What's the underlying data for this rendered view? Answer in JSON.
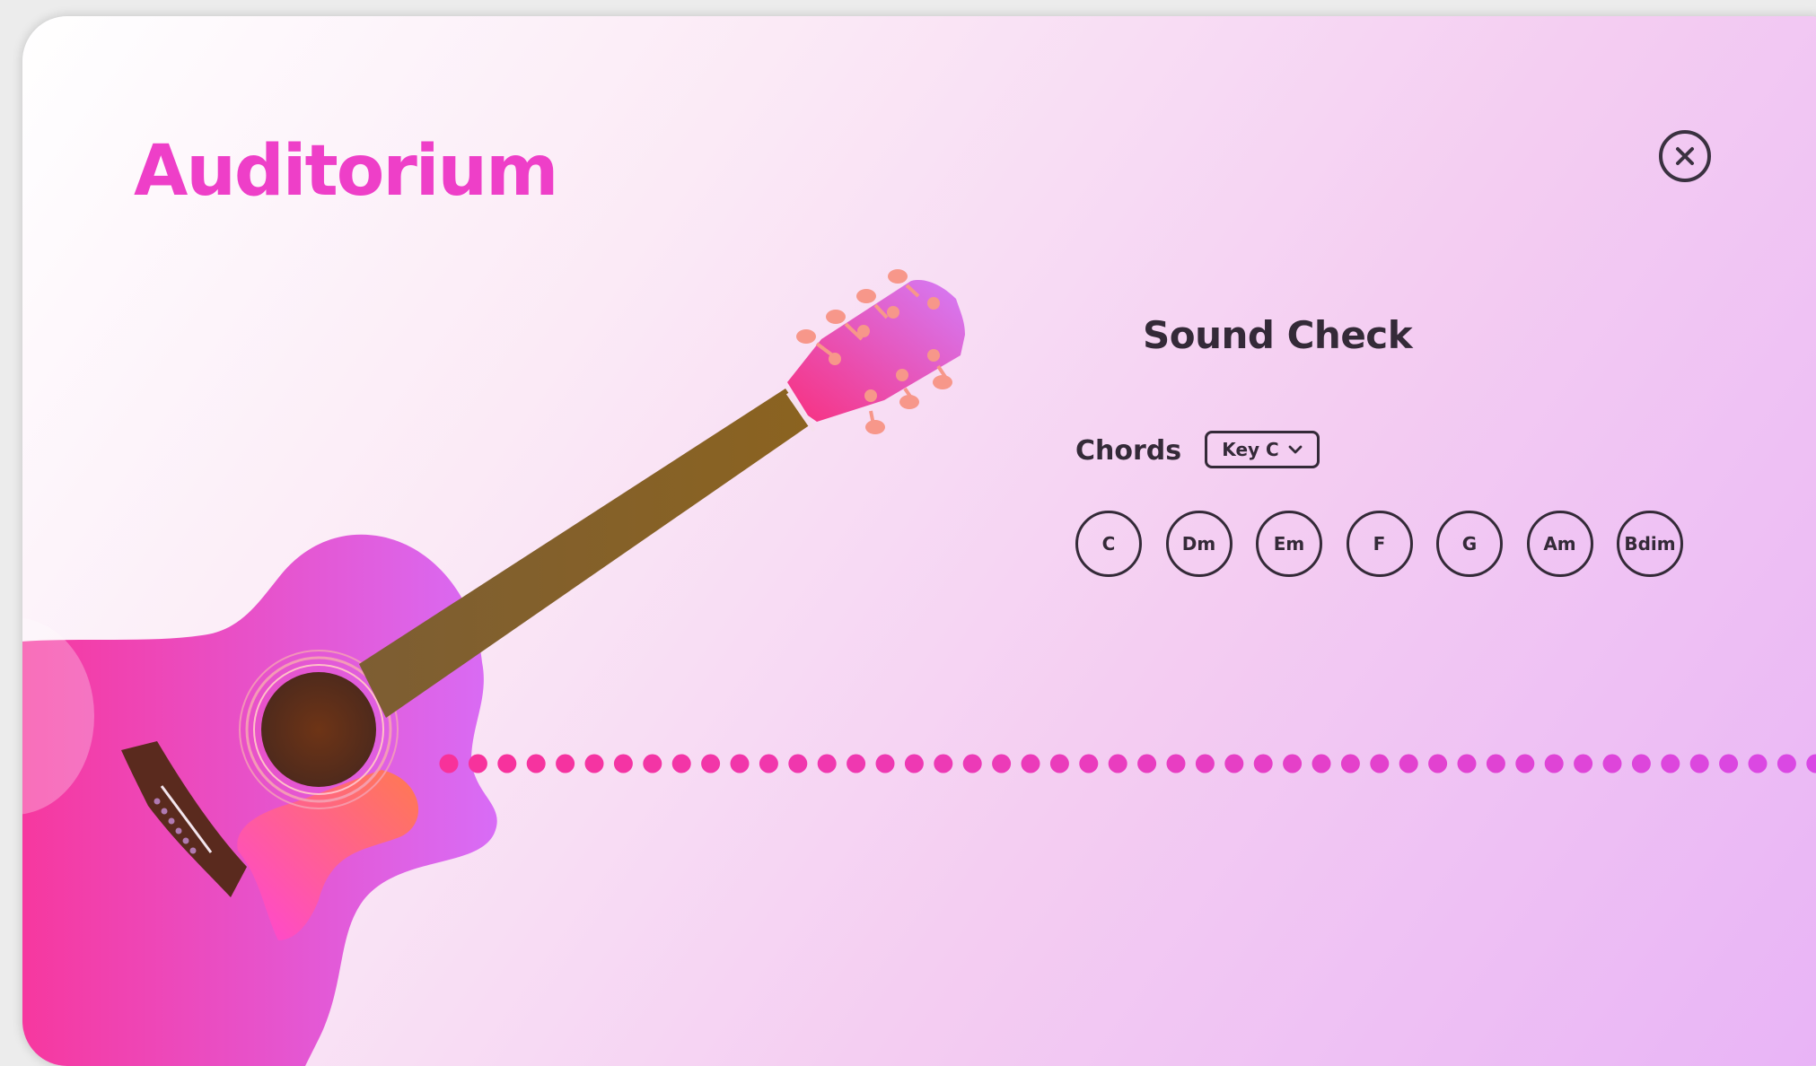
{
  "app": {
    "title": "Auditorium",
    "close_icon": "close-icon"
  },
  "sound_check": {
    "icon": "waveform-icon",
    "title": "Sound Check",
    "chords_label": "Chords",
    "key_select": {
      "selected": "Key C",
      "icon": "chevron-down-icon"
    },
    "chords": [
      "C",
      "Dm",
      "Em",
      "F",
      "G",
      "Am",
      "Bdim"
    ]
  },
  "colors": {
    "accent": "#ee3fc8",
    "text_dark": "#342a38",
    "dot_start": "#f8319a",
    "dot_end": "#d84ae8",
    "guitar_body_start": "#f8359a",
    "guitar_body_end": "#d86cf6",
    "neck": "#8a6320",
    "soundhole": "#5a2a1a",
    "tuning_pegs": "#f7978a"
  }
}
